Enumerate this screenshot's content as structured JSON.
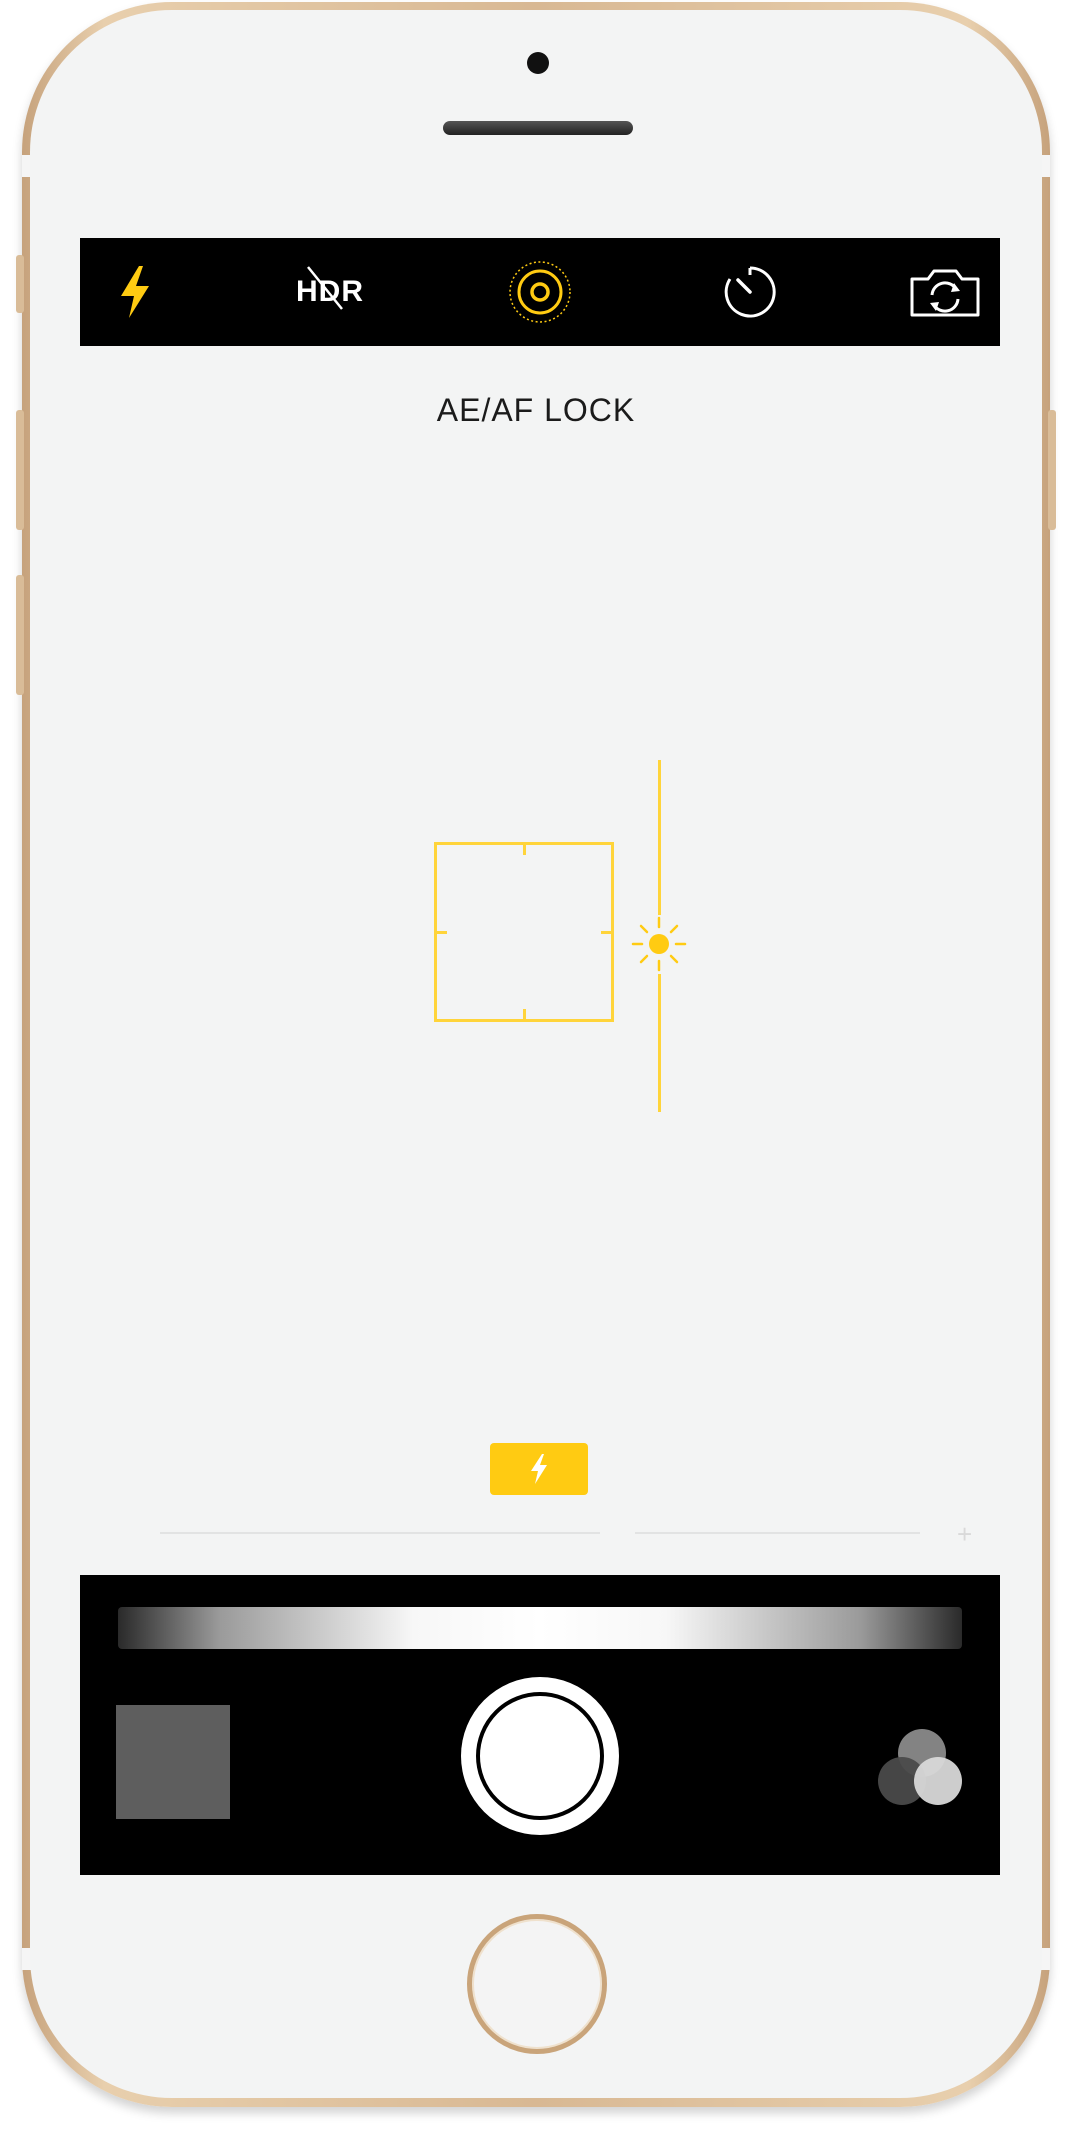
{
  "device": {
    "model": "iPhone",
    "frame_color": "#d8b893",
    "screen_color": "#f3f4f4"
  },
  "top_bar": {
    "flash_icon": "flash-icon",
    "hdr_label": "HDR",
    "live_photo_icon": "live-photo-icon",
    "timer_icon": "timer-icon",
    "switch_camera_icon": "switch-camera-icon",
    "accent_color": "#ffcb12"
  },
  "viewfinder": {
    "lock_label": "AE/AF LOCK",
    "focus_color": "#ffd43a",
    "exposure_icon": "sun-icon",
    "flash_indicator_icon": "flash-icon"
  },
  "bottom_bar": {
    "mode_slider": "mode-slider",
    "thumbnail_icon": "last-photo-thumbnail",
    "shutter_icon": "shutter-button",
    "filters_icon": "filters-icon"
  }
}
